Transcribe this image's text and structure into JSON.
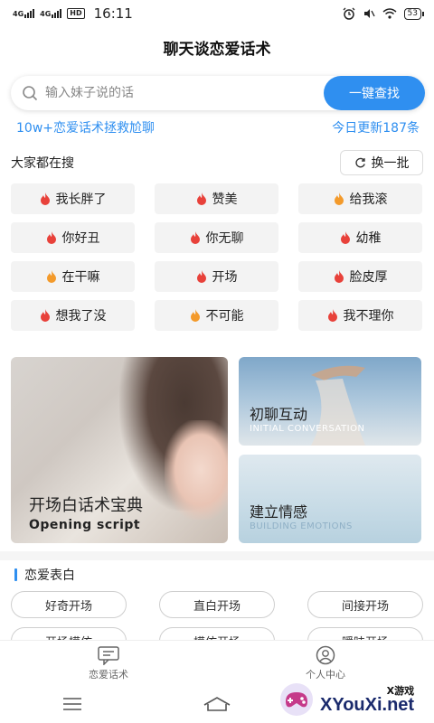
{
  "status_bar": {
    "net1": "4G",
    "net2": "4G",
    "hd": "HD",
    "time": "16:11",
    "battery": "53"
  },
  "header": {
    "title": "聊天谈恋爱话术"
  },
  "search": {
    "placeholder": "输入妹子说的话",
    "value": "",
    "button_label": "一键查找"
  },
  "promo": {
    "left_text": "10w+恋爱话术拯救尬聊",
    "right_text": "今日更新187条"
  },
  "hot": {
    "title": "大家都在搜",
    "refresh_label": "换一批",
    "tags": [
      {
        "label": "我长胖了",
        "flame": "red"
      },
      {
        "label": "赞美",
        "flame": "red"
      },
      {
        "label": "给我滚",
        "flame": "orange"
      },
      {
        "label": "你好丑",
        "flame": "red"
      },
      {
        "label": "你无聊",
        "flame": "red"
      },
      {
        "label": "幼稚",
        "flame": "red"
      },
      {
        "label": "在干嘛",
        "flame": "orange"
      },
      {
        "label": "开场",
        "flame": "red"
      },
      {
        "label": "脸皮厚",
        "flame": "red"
      },
      {
        "label": "想我了没",
        "flame": "red"
      },
      {
        "label": "不可能",
        "flame": "orange"
      },
      {
        "label": "我不理你",
        "flame": "red"
      }
    ]
  },
  "cards": {
    "big": {
      "title": "开场白话术宝典",
      "subtitle": "Opening script"
    },
    "small1": {
      "title": "初聊互动",
      "subtitle": "INITIAL CONVERSATION"
    },
    "small2": {
      "title": "建立情感",
      "subtitle": "BUILDING EMOTIONS"
    }
  },
  "section": {
    "title": "恋爱表白",
    "pills": [
      "好奇开场",
      "直白开场",
      "间接开场",
      "开场模仿",
      "模仿开场",
      "暧昧开场"
    ]
  },
  "tabbar": {
    "items": [
      {
        "label": "恋爱话术",
        "icon": "chat-icon"
      },
      {
        "label": "个人中心",
        "icon": "user-icon"
      }
    ]
  },
  "watermark": {
    "small": "X游戏",
    "big": "XYouXi.net"
  },
  "colors": {
    "accent": "#2f8ff0",
    "flame_red": "#e8413a",
    "flame_orange": "#f39a2b"
  }
}
